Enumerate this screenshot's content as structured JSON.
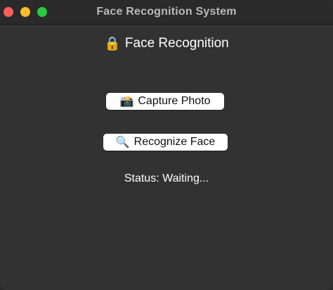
{
  "window": {
    "title": "Face Recognition System"
  },
  "main": {
    "heading_icon": "🔒",
    "heading": "Face Recognition",
    "capture_button": {
      "icon": "📸",
      "label": "Capture Photo"
    },
    "recognize_button": {
      "icon": "🔍",
      "label": "Recognize Face"
    },
    "status": "Status: Waiting..."
  },
  "colors": {
    "background": "#323232",
    "titlebar": "#2a2a2a",
    "close": "#ff5f57",
    "minimize": "#febc2e",
    "maximize": "#28c840",
    "button_bg": "#ffffff",
    "text": "#ffffff"
  },
  "icons": {
    "heading": "lock-icon",
    "capture": "camera-icon",
    "recognize": "magnifier-icon"
  }
}
